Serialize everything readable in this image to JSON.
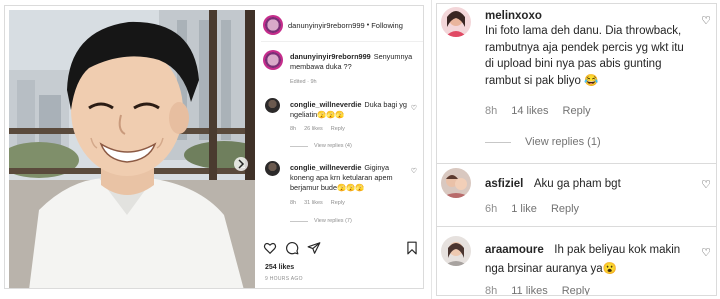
{
  "post": {
    "username": "danunyinyir9reborn999",
    "separator": "•",
    "following_label": "Following",
    "more_label": "···",
    "caption": {
      "user": "danunyinyir9reborn999",
      "text": "Senyumnya membawa duka ??",
      "meta": "Edited · 9h"
    },
    "comments": [
      {
        "user": "conglie_willneverdie",
        "text": "Duka bagi yg ngeliatin🫣🫣🫣",
        "time": "8h",
        "likes": "26 likes",
        "reply": "Reply",
        "view_replies": "View replies (4)"
      },
      {
        "user": "conglie_willneverdie",
        "text": "Giginya koneng apa krn ketularan apem berjamur bude🫣🫣🫣",
        "time": "8h",
        "likes": "31 likes",
        "reply": "Reply",
        "view_replies": "View replies (7)"
      }
    ],
    "likes_count": "254 likes",
    "time_ago": "9 HOURS AGO"
  },
  "right_comments": [
    {
      "user": "melinxoxo",
      "text": "Ini foto lama deh danu. Dia throwback, rambutnya aja pendek percis yg wkt itu di upload bini nya pas abis gunting rambut si pak bliyo 😂",
      "time": "8h",
      "likes": "14 likes",
      "reply": "Reply",
      "view_replies": "View replies (1)"
    },
    {
      "user": "asfiziel",
      "text": "Aku ga pham bgt",
      "time": "6h",
      "likes": "1 like",
      "reply": "Reply"
    },
    {
      "user": "araamoure",
      "text": "Ih pak beliyau kok makin nga brsinar auranya ya😮",
      "time": "8h",
      "likes": "11 likes",
      "reply": "Reply"
    }
  ],
  "icons": {
    "heart": "heart-icon",
    "comment": "comment-icon",
    "share": "share-icon",
    "bookmark": "bookmark-icon",
    "more": "more-options-icon"
  },
  "colors": {
    "text_primary": "#262626",
    "text_secondary": "#8e8e8e",
    "border": "#dbdbdb"
  }
}
